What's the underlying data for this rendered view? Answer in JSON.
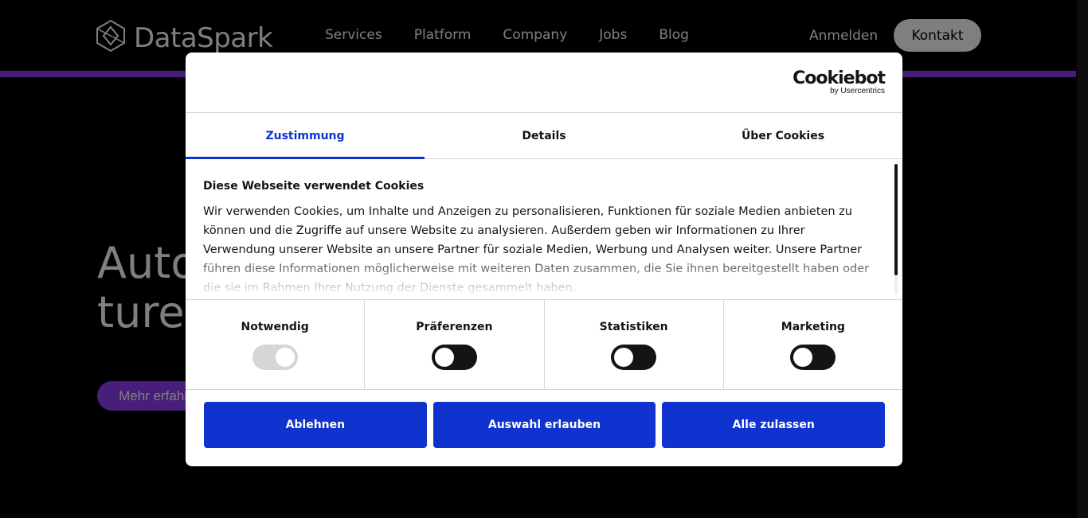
{
  "site": {
    "logo_text": "DataSpark",
    "nav": [
      "Services",
      "Platform",
      "Company",
      "Jobs",
      "Blog"
    ],
    "login": "Anmelden",
    "contact": "Kontakt",
    "hero_title": "Automating the Fu- ture Through AI",
    "hero_button": "Mehr erfahren",
    "accent_color": "#8e3ff5"
  },
  "dialog": {
    "brand": {
      "name": "Cookiebot",
      "sub": "by Usercentrics"
    },
    "tabs": [
      {
        "label": "Zustimmung",
        "active": true
      },
      {
        "label": "Details",
        "active": false
      },
      {
        "label": "Über Cookies",
        "active": false
      }
    ],
    "content_title": "Diese Webseite verwendet Cookies",
    "content_text": "Wir verwenden Cookies, um Inhalte und Anzeigen zu personalisieren, Funktionen für soziale Medien anbieten zu können und die Zugriffe auf unsere Website zu analysieren. Außerdem geben wir Informationen zu Ihrer Verwendung unserer Website an unsere Partner für soziale Medien, Werbung und Analysen weiter. Unsere Partner führen diese Informationen möglicherweise mit weiteren Daten zusammen, die Sie ihnen bereitgestellt haben oder die sie im Rahmen Ihrer Nutzung der Dienste gesammelt haben.",
    "toggles": [
      {
        "label": "Notwendig",
        "on": true,
        "disabled": true
      },
      {
        "label": "Präferenzen",
        "on": false,
        "disabled": false
      },
      {
        "label": "Statistiken",
        "on": false,
        "disabled": false
      },
      {
        "label": "Marketing",
        "on": false,
        "disabled": false
      }
    ],
    "buttons": {
      "deny": "Ablehnen",
      "allow_selection": "Auswahl erlauben",
      "allow_all": "Alle zulassen"
    },
    "accent_color": "#1032cf"
  }
}
